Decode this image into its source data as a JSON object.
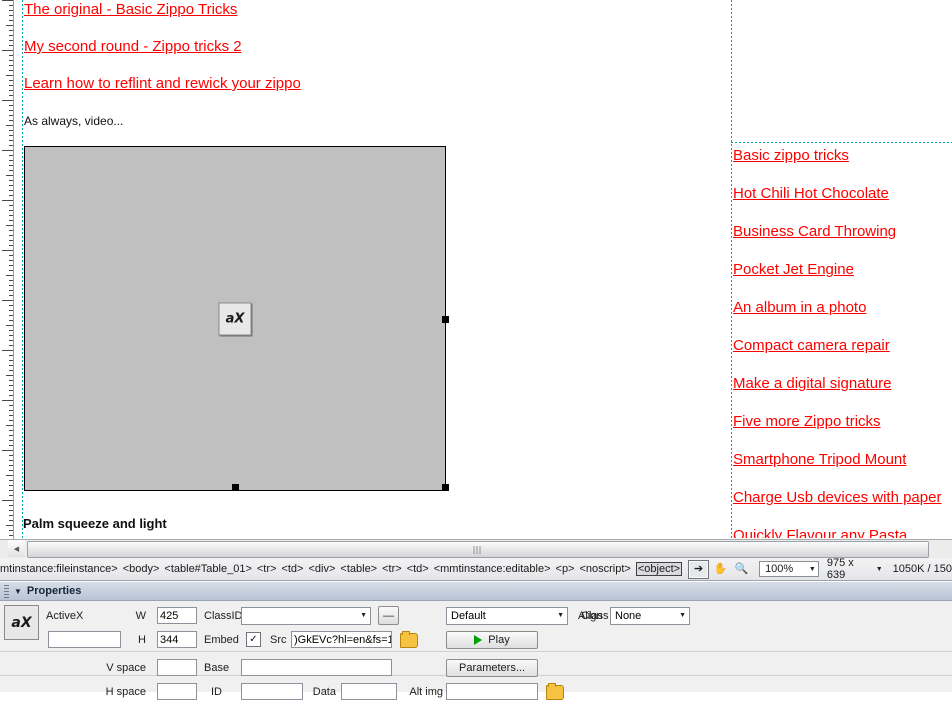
{
  "document": {
    "top_links": [
      "The original - Basic Zippo Tricks",
      "My second round - Zippo tricks 2",
      "Learn how to reflint and rewick your zippo"
    ],
    "body_text": "As always, video...",
    "caption": "Palm squeeze and light",
    "object_placeholder_icon": "activex-icon",
    "object_icon_label": "aX",
    "sidebar_links": [
      "Basic zippo tricks",
      "Hot Chili Hot Chocolate",
      "Business Card Throwing",
      "Pocket Jet Engine",
      "An album in a photo",
      "Compact camera repair",
      "Make a digital signature",
      "Five more Zippo tricks",
      "Smartphone Tripod Mount",
      "Charge Usb devices with paper",
      "Quickly Flavour any Pasta"
    ]
  },
  "statusbar": {
    "tags": [
      "mtinstance:fileinstance>",
      "<body>",
      "<table#Table_01>",
      "<tr>",
      "<td>",
      "<div>",
      "<table>",
      "<tr>",
      "<td>",
      "<mmtinstance:editable>",
      "<p>",
      "<noscript>"
    ],
    "selected_tag": "<object>",
    "tools": {
      "select": "pointer-icon",
      "hand": "hand-icon",
      "zoom": "magnifier-icon"
    },
    "zoom_level": "100%",
    "window_size": "975 x 639",
    "doc_size": "1050K / 150"
  },
  "properties": {
    "title": "Properties",
    "collapse_icon": "triangle-down-icon",
    "object_type": "ActiveX",
    "name_value": "",
    "name_placeholder": "",
    "labels": {
      "w": "W",
      "h": "H",
      "classid": "ClassID",
      "embed": "Embed",
      "src": "Src",
      "align": "Align",
      "class": "Class",
      "vspace": "V space",
      "hspace": "H space",
      "base": "Base",
      "id": "ID",
      "data": "Data",
      "altimg": "Alt img"
    },
    "w_value": "425",
    "h_value": "344",
    "classid_value": "",
    "embed_checked": "✓",
    "src_value": ")GkEVc?hl=en&fs=1",
    "align_value": "Default",
    "class_value": "None",
    "vspace_value": "",
    "hspace_value": "",
    "base_value": "",
    "id_value": "",
    "data_value": "",
    "altimg_value": "",
    "play_button": "Play",
    "parameters_button": "Parameters...",
    "minus_button": "—",
    "folder_icon": "folder-browse-icon"
  }
}
